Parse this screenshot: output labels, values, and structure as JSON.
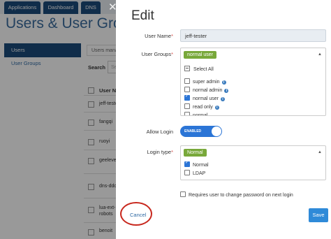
{
  "background": {
    "nav_tabs": [
      "Applications",
      "Dashboard",
      "DNS"
    ],
    "page_title": "Users & User Groups",
    "sidebar": {
      "active_item": "Users",
      "items": [
        "User Groups"
      ]
    },
    "tab_label": "Users manag",
    "search_label": "Search",
    "search_placeholder": "Se",
    "column_header": "User Nam",
    "rows": [
      "jeff-tester",
      "fangqi",
      "ruoyi",
      "geelevel",
      "dns-ddos",
      "lua-ext-robots",
      "benoit"
    ]
  },
  "modal": {
    "title": "Edit",
    "user_name": {
      "label": "User Name",
      "value": "jeff-tester"
    },
    "user_groups": {
      "label": "User Groups",
      "selected_tag": "normal user",
      "select_all": "Select All",
      "options": [
        {
          "label": "super admin",
          "checked": false
        },
        {
          "label": "normal admin",
          "checked": false
        },
        {
          "label": "normal user",
          "checked": true
        },
        {
          "label": "read only",
          "checked": false
        },
        {
          "label": "normal",
          "checked": false
        }
      ]
    },
    "allow_login": {
      "label": "Allow Login",
      "state": "ENABLED"
    },
    "login_type": {
      "label": "Login type",
      "selected_tag": "Normal",
      "options": [
        {
          "label": "Normal",
          "checked": true
        },
        {
          "label": "LDAP",
          "checked": false
        }
      ]
    },
    "require_change": "Requires user to change password on next login",
    "cancel_label": "Cancel",
    "save_label": "Save",
    "required_mark": "*"
  },
  "colors": {
    "nav": "#1c4c7c",
    "accent": "#2b75d6",
    "tag": "#78a83a",
    "highlight_ring": "#c8281e",
    "required": "#d9534f"
  },
  "icons": [
    "close-icon",
    "chevron-up-icon",
    "info-icon",
    "check-icon"
  ]
}
